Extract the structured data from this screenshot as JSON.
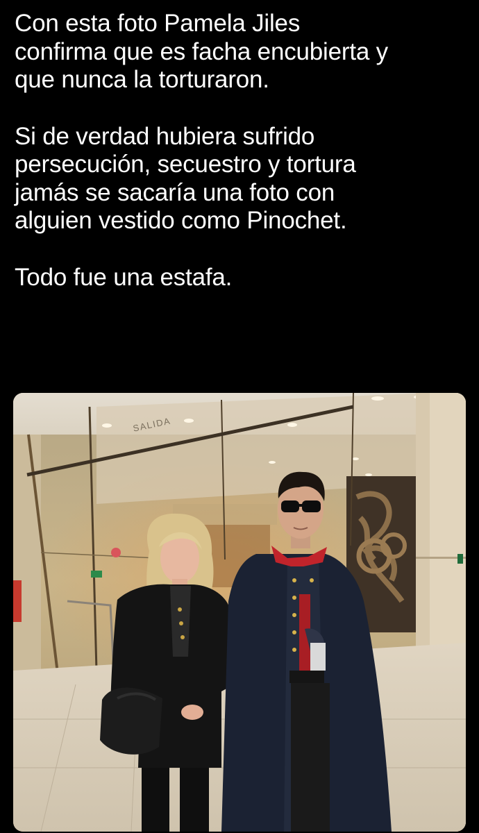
{
  "tweet": {
    "paragraphs": [
      "Con esta foto Pamela Jiles\nconfirma que es facha encubierta y\nque nunca la torturaron.",
      "Si de verdad hubiera sufrido\npersecución, secuestro y tortura\njamás se sacaría una foto con\nalguien vestido como Pinochet.",
      "Todo fue una estafa."
    ]
  },
  "photo": {
    "sign_text": "SALIDA"
  }
}
